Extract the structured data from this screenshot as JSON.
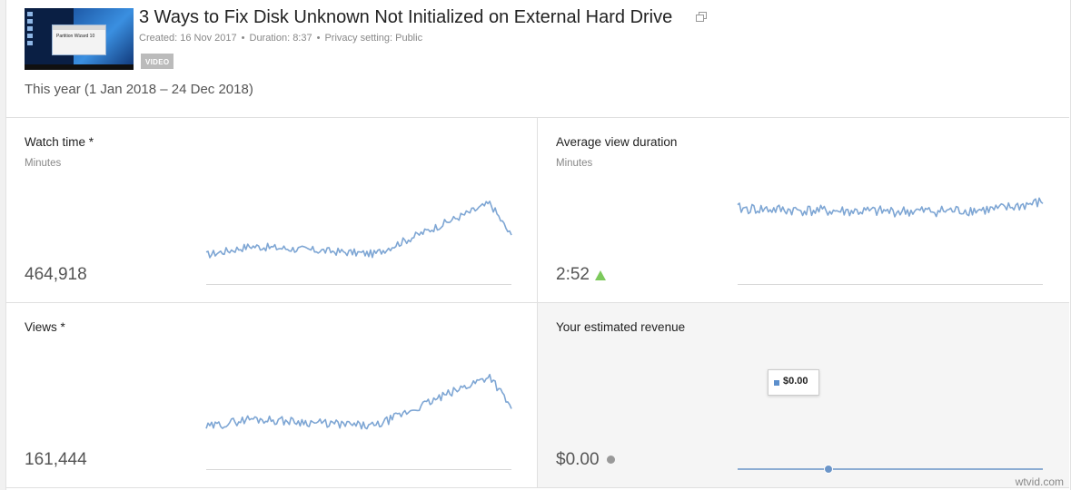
{
  "video": {
    "title": "3 Ways to Fix Disk Unknown Not Initialized on External Hard Drive",
    "created": "Created: 16 Nov 2017",
    "duration": "Duration: 8:37",
    "privacy": "Privacy setting: Public",
    "dot": "•",
    "badge": "VIDEO",
    "thumbnail_text": "Partition Wizard 10"
  },
  "date_range": "This year (1 Jan 2018 – 24 Dec 2018)",
  "colors": {
    "line": "#7ea6d4",
    "accent_up": "#7cc95c"
  },
  "cards": {
    "watch_time": {
      "title": "Watch time *",
      "unit": "Minutes",
      "value": "464,918"
    },
    "avg_view_duration": {
      "title": "Average view duration",
      "unit": "Minutes",
      "value": "2:52",
      "trend": "up"
    },
    "views": {
      "title": "Views *",
      "value": "161,444"
    },
    "revenue": {
      "title": "Your estimated revenue",
      "value": "$0.00",
      "tooltip": "$0.00"
    }
  },
  "icons": [
    "external-link-icon",
    "trend-up-icon",
    "revenue-indicator-icon"
  ],
  "watermark": "wtvid.com"
}
